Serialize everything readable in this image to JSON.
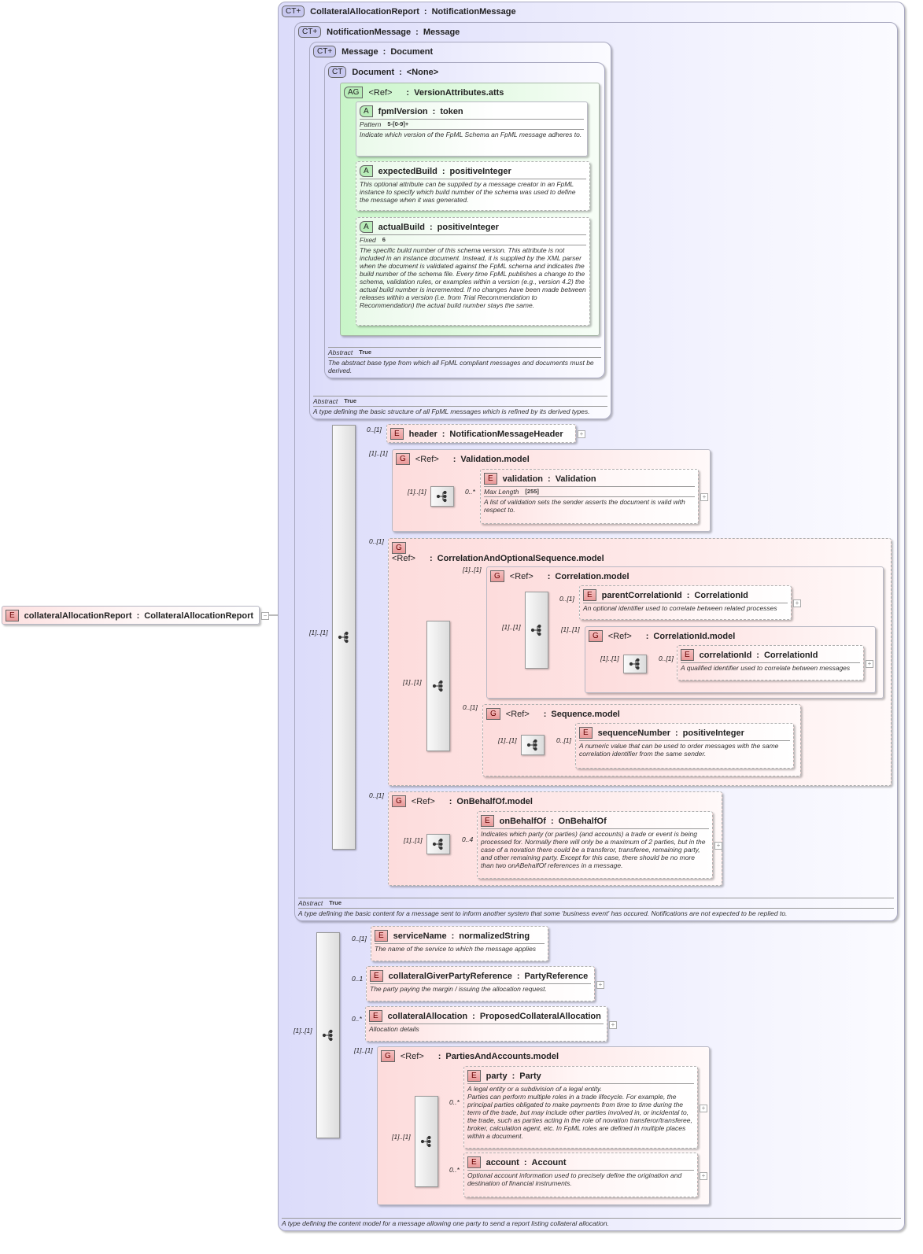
{
  "nodes": [
    {
      "id": "ct1",
      "kind": "ct",
      "badge": "CT+",
      "name": "CollateralAllocationReport",
      "type": "NotificationMessage",
      "desc": "A type defining the content model for a message allowing one party to send a report listing collateral allocation."
    },
    {
      "id": "ct2",
      "kind": "ct",
      "badge": "CT+",
      "name": "NotificationMessage",
      "type": "Message",
      "facet": {
        "label": "Abstract",
        "value": "True"
      },
      "desc": "A type defining the basic content for a message sent to inform another system that some 'business event' has occured. Notifications are not expected to be replied to."
    },
    {
      "id": "ct3",
      "kind": "ct",
      "badge": "CT+",
      "name": "Message",
      "type": "Document",
      "facet": {
        "label": "Abstract",
        "value": "True"
      },
      "desc": "A type defining the basic structure of all FpML messages which is refined by its derived types."
    },
    {
      "id": "ct4",
      "kind": "ct",
      "badge": "CT",
      "name": "Document",
      "type": "<None>",
      "facet": {
        "label": "Abstract",
        "value": "True"
      },
      "desc": "The abstract base type from which all FpML compliant messages and documents must be derived."
    },
    {
      "id": "ag",
      "kind": "ag",
      "badge": "AG",
      "ref": "<Ref>",
      "type": "VersionAttributes.atts"
    },
    {
      "id": "fpmlVersion",
      "kind": "a",
      "badge": "A",
      "name": "fpmlVersion",
      "type": "token",
      "facet": {
        "label": "Pattern",
        "value": "5-[0-9]+"
      },
      "desc": "Indicate which version of the FpML Schema an FpML message adheres to."
    },
    {
      "id": "expectedBuild",
      "kind": "a",
      "badge": "A",
      "name": "expectedBuild",
      "type": "positiveInteger",
      "desc": "This optional attribute can be supplied by a message creator in an FpML instance to specify which build number of the schema was used to define the message when it was generated."
    },
    {
      "id": "actualBuild",
      "kind": "a",
      "badge": "A",
      "name": "actualBuild",
      "type": "positiveInteger",
      "facet": {
        "label": "Fixed",
        "value": "6"
      },
      "desc": "The specific build number of this schema version. This attribute is not included in an instance document. Instead, it is supplied by the XML parser when the document is validated against the FpML schema and indicates the build number of the schema file. Every time FpML publishes a change to the schema, validation rules, or examples within a version (e.g., version 4.2) the actual build number is incremented. If no changes have been made between releases within a version (i.e. from Trial Recommendation to Recommendation) the actual build number stays the same."
    },
    {
      "id": "header",
      "kind": "e",
      "badge": "E",
      "name": "header",
      "type": "NotificationMessageHeader",
      "occurs": "0..[1]",
      "expandable": true
    },
    {
      "id": "gValidation",
      "kind": "g",
      "badge": "G",
      "ref": "<Ref>",
      "type": "Validation.model",
      "occurs": "[1]..[1]",
      "seq_occurs": "[1]..[1]"
    },
    {
      "id": "validation",
      "kind": "e",
      "badge": "E",
      "name": "validation",
      "type": "Validation",
      "occurs": "0..*",
      "facet": {
        "label": "Max Length",
        "value": "[255]"
      },
      "desc": "A list of validation sets the sender asserts the document is valid with respect to.",
      "expandable": true
    },
    {
      "id": "gCAOS",
      "kind": "g",
      "badge": "G",
      "ref": "<Ref>",
      "type": "CorrelationAndOptionalSequence.model",
      "occurs": "0..[1]",
      "seq_occurs": "[1]..[1]"
    },
    {
      "id": "gCorrelation",
      "kind": "g",
      "badge": "G",
      "ref": "<Ref>",
      "type": "Correlation.model",
      "occurs": "[1]..[1]",
      "seq_occurs": "[1]..[1]"
    },
    {
      "id": "parentCorrelationId",
      "kind": "e",
      "badge": "E",
      "name": "parentCorrelationId",
      "type": "CorrelationId",
      "occurs": "0..[1]",
      "desc": "An optional identifier used to correlate between related processes",
      "expandable": true
    },
    {
      "id": "gCorrelationId",
      "kind": "g",
      "badge": "G",
      "ref": "<Ref>",
      "type": "CorrelationId.model",
      "occurs": "[1]..[1]",
      "seq_occurs": "[1]..[1]"
    },
    {
      "id": "correlationId",
      "kind": "e",
      "badge": "E",
      "name": "correlationId",
      "type": "CorrelationId",
      "occurs": "0..[1]",
      "desc": "A qualified identifier used to correlate between messages",
      "expandable": true
    },
    {
      "id": "gSequence",
      "kind": "g",
      "badge": "G",
      "ref": "<Ref>",
      "type": "Sequence.model",
      "occurs": "0..[1]",
      "seq_occurs": "[1]..[1]"
    },
    {
      "id": "sequenceNumber",
      "kind": "e",
      "badge": "E",
      "name": "sequenceNumber",
      "type": "positiveInteger",
      "occurs": "0..[1]",
      "desc": "A numeric value that can be used to order messages with the same correlation identifier from the same sender."
    },
    {
      "id": "gOnBehalfOf",
      "kind": "g",
      "badge": "G",
      "ref": "<Ref>",
      "type": "OnBehalfOf.model",
      "occurs": "0..[1]",
      "seq_occurs": "[1]..[1]"
    },
    {
      "id": "onBehalfOf",
      "kind": "e",
      "badge": "E",
      "name": "onBehalfOf",
      "type": "OnBehalfOf",
      "occurs": "0..4",
      "desc": "Indicates which party (or parties) (and accounts) a trade or event is being processed for. Normally there will only be a maximum of 2 parties, but in the case of a novation there could be a transferor, transferee, remaining party, and other remaining party. Except for this case, there should be no more than two onABehalfOf references in a message.",
      "expandable": true
    },
    {
      "id": "serviceName",
      "kind": "e",
      "badge": "E",
      "name": "serviceName",
      "type": "normalizedString",
      "occurs": "0..[1]",
      "desc": "The name of the service to which the message applies"
    },
    {
      "id": "collateralGiverPartyReference",
      "kind": "e",
      "badge": "E",
      "name": "collateralGiverPartyReference",
      "type": "PartyReference",
      "occurs": "0..1",
      "desc": "The party paying the margin / issuing the allocation request.",
      "expandable": true
    },
    {
      "id": "collateralAllocation",
      "kind": "e",
      "badge": "E",
      "name": "collateralAllocation",
      "type": "ProposedCollateralAllocation",
      "occurs": "0..*",
      "desc": "Allocation details",
      "expandable": true
    },
    {
      "id": "gParties",
      "kind": "g",
      "badge": "G",
      "ref": "<Ref>",
      "type": "PartiesAndAccounts.model",
      "occurs": "[1]..[1]",
      "seq_occurs": "[1]..[1]"
    },
    {
      "id": "party",
      "kind": "e",
      "badge": "E",
      "name": "party",
      "type": "Party",
      "occurs": "0..*",
      "desc": "A legal entity or a subdivision of a legal entity.\nParties can perform multiple roles in a trade lifecycle. For example, the principal parties obligated to make payments from time to time during the term of the trade, but may include other parties involved in, or incidental to, the trade, such as parties acting in the role of novation transferor/transferee, broker, calculation agent, etc. In FpML roles are defined in multiple places within a document.",
      "expandable": true
    },
    {
      "id": "account",
      "kind": "e",
      "badge": "E",
      "name": "account",
      "type": "Account",
      "occurs": "0..*",
      "desc": "Optional account information used to precisely define the origination and destination of financial instruments.",
      "expandable": true
    },
    {
      "id": "root",
      "kind": "e",
      "badge": "E",
      "name": "collateralAllocationReport",
      "type": "CollateralAllocationReport",
      "collapsible": true
    }
  ],
  "sequences": [
    {
      "id": "seq1",
      "occurs": "[1]..[1]"
    },
    {
      "id": "seq2",
      "occurs": "[1]..[1]"
    }
  ]
}
